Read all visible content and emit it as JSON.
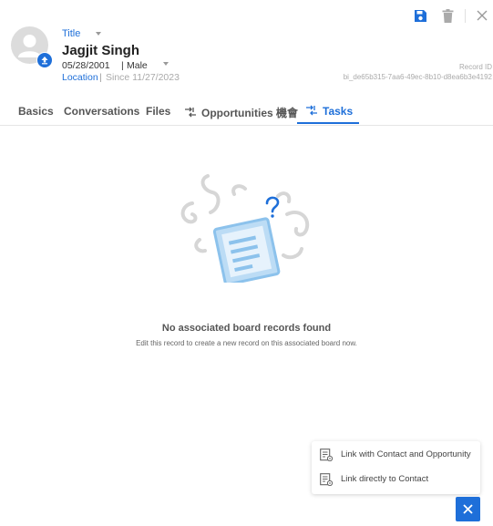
{
  "header": {
    "title_select": "Title",
    "name": "Jagjit Singh",
    "dob": "05/28/2001",
    "separator": "|",
    "gender": "Male",
    "location": "Location",
    "since": "Since 11/27/2023",
    "record_id_label": "Record ID",
    "record_id": "bi_de65b315-7aa6-49ec-8b10-d8ea6b3e4192"
  },
  "toolbar": {
    "icons": [
      "save-icon",
      "delete-icon",
      "close-icon"
    ],
    "accent_color": "#1e6fd9"
  },
  "tabs": [
    {
      "label": "Basics",
      "active": false
    },
    {
      "label": "Conversations",
      "active": false
    },
    {
      "label": "Files",
      "active": false
    },
    {
      "label": "Opportunities 機會",
      "active": false,
      "icon": "link-arrows-icon"
    },
    {
      "label": "Tasks",
      "active": true,
      "icon": "link-arrows-icon"
    }
  ],
  "empty_state": {
    "title": "No associated board records found",
    "subtitle": "Edit this record to create a new record on this associated board now."
  },
  "link_menu": {
    "items": [
      {
        "label": "Link with Contact and Opportunity",
        "icon": "link-list-icon"
      },
      {
        "label": "Link directly to Contact",
        "icon": "link-list-icon"
      }
    ]
  },
  "fab": {
    "icon": "close-icon"
  }
}
